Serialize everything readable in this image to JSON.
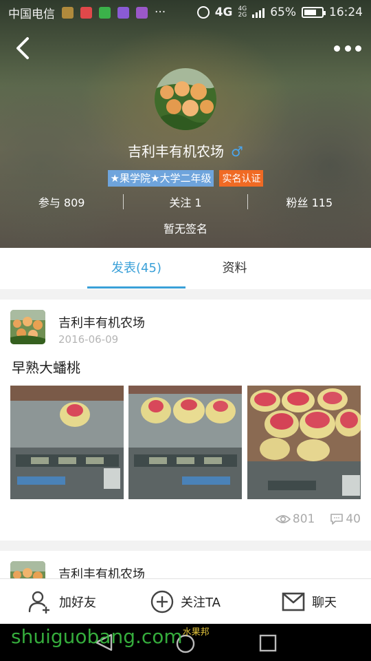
{
  "status_bar": {
    "carrier": "中国电信",
    "more": "···",
    "network": "4G",
    "network_small_top": "4G",
    "network_small_bottom": "2G",
    "battery": "65%",
    "battery_level": 0.65,
    "time": "16:24"
  },
  "profile": {
    "name": "吉利丰有机农场",
    "gender_symbol": "♂",
    "school_tag": "★果学院★大学二年级",
    "verify_tag": "实名认证",
    "stats": [
      {
        "label": "参与 809"
      },
      {
        "label": "关注 1"
      },
      {
        "label": "粉丝 115"
      }
    ],
    "signature": "暂无签名"
  },
  "tabs": [
    {
      "label": "发表(45)",
      "active": true
    },
    {
      "label": "资料",
      "active": false
    }
  ],
  "posts": [
    {
      "author": "吉利丰有机农场",
      "date": "2016-06-09",
      "title": "早熟大蟠桃",
      "views": "801",
      "comments": "40"
    },
    {
      "author": "吉利丰有机农场"
    }
  ],
  "actions": {
    "add_friend": "加好友",
    "follow": "关注TA",
    "chat": "聊天"
  },
  "watermark": {
    "text": "shuiguobang.com",
    "small": "水果邦"
  },
  "colors": {
    "accent": "#3aa0d8",
    "verify": "#f06a24",
    "school_tag": "#6ea4dc",
    "gender": "#4aa6ef",
    "watermark": "#38b640"
  }
}
